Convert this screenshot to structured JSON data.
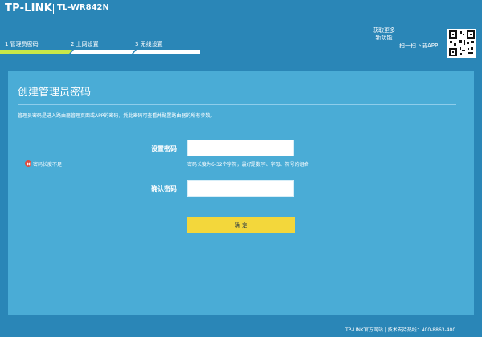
{
  "header": {
    "brand": "TP-LINK",
    "model": "TL-WR842N"
  },
  "steps": [
    {
      "label": "1 管理员密码",
      "active": true
    },
    {
      "label": "2 上网设置",
      "active": false
    },
    {
      "label": "3 无线设置",
      "active": false
    }
  ],
  "app": {
    "get_more_line1": "获取更多",
    "get_more_line2": "新功能",
    "scan_text": "扫一扫下载APP"
  },
  "form": {
    "title": "创建管理员密码",
    "description": "管理员密码是进入路由器管理页面或APP的密码，凭此密码可查看并配置路由器的所有参数。",
    "password_label": "设置密码",
    "password_value": "",
    "password_hint": "密码长度为6-32个字符，最好是数字、字母、符号的组合",
    "error_text": "密码长度不足",
    "confirm_label": "确认密码",
    "confirm_value": "",
    "button_label": "确 定"
  },
  "footer": {
    "text": "TP-LINK官方网站  |  技术支持热线：400-8863-400"
  }
}
